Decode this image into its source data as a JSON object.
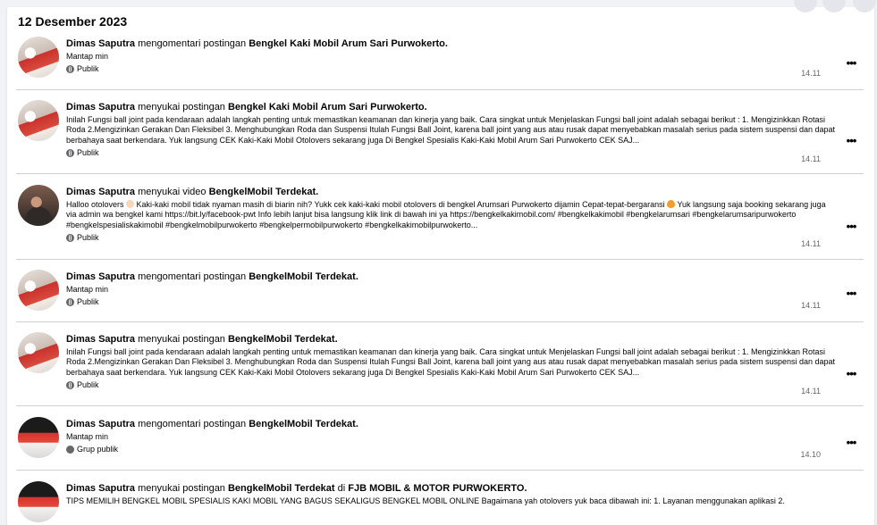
{
  "date_header": "12 Desember 2023",
  "actor": "Dimas Saputra",
  "entries": [
    {
      "avatar": "post-thumbnail",
      "action": " mengomentari postingan ",
      "target": "Bengkel Kaki Mobil Arum Sari Purwokerto.",
      "comment": "Mantap min",
      "description": "",
      "privacy": "Publik",
      "privacy_icon": "globe-icon",
      "time": "14.11"
    },
    {
      "avatar": "post-thumbnail",
      "action": " menyukai postingan ",
      "target": "Bengkel Kaki Mobil Arum Sari Purwokerto.",
      "comment": "",
      "description": "Inilah Fungsi ball joint pada kendaraan adalah langkah penting untuk memastikan keamanan dan kinerja yang baik. Cara singkat untuk Menjelaskan Fungsi ball joint adalah sebagai berikut : 1. Mengizinkkan Rotasi Roda 2.Mengizinkan Gerakan Dan Fleksibel 3. Menghubungkan Roda dan Suspensi Itulah Fungsi Ball Joint, karena ball joint yang aus atau rusak dapat menyebabkan masalah serius pada sistem suspensi dan dapat berbahaya saat berkendara. Yuk langsung CEK Kaki-Kaki Mobil Otolovers sekarang juga Di Bengkel Spesialis Kaki-Kaki Mobil Arum Sari Purwokerto CEK SAJ...",
      "privacy": "Publik",
      "privacy_icon": "globe-icon",
      "time": "14.11"
    },
    {
      "avatar": "person-photo",
      "action": " menyukai video ",
      "target": "BengkelMobil Terdekat.",
      "comment": "",
      "description_parts": [
        "Halloo otolovers ",
        " Kaki-kaki mobil tidak nyaman masih di biarin nih? Yukk cek kaki-kaki mobil otolovers di bengkel Arumsari Purwokerto dijamin Cepat-tepat-bergaransi ",
        " Yuk langsung saja booking sekarang juga via admin wa bengkel kami https://bit.ly/facebook-pwt Info lebih lanjut bisa langsung klik link di bawah ini ya https://bengkelkakimobil.com/ #bengkelkakimobil #bengkelarumsari #bengkelarumsaripurwokerto #bengkelspesialiskakimobil #bengkelmobilpurwokerto #bengkelpermobilpurwokerto #bengkelkakimobilpurwokerto..."
      ],
      "privacy": "Publik",
      "privacy_icon": "globe-icon",
      "time": "14.11"
    },
    {
      "avatar": "post-thumbnail",
      "action": " mengomentari postingan ",
      "target": "BengkelMobil Terdekat.",
      "comment": "Mantap min",
      "description": "",
      "privacy": "Publik",
      "privacy_icon": "globe-icon",
      "time": "14.11"
    },
    {
      "avatar": "post-thumbnail",
      "action": " menyukai postingan ",
      "target": "BengkelMobil Terdekat.",
      "comment": "",
      "description": "Inilah Fungsi ball joint pada kendaraan adalah langkah penting untuk memastikan keamanan dan kinerja yang baik. Cara singkat untuk Menjelaskan Fungsi ball joint adalah sebagai berikut : 1. Mengizinkkan Rotasi Roda 2.Mengizinkan Gerakan Dan Fleksibel 3. Menghubungkan Roda dan Suspensi Itulah Fungsi Ball Joint, karena ball joint yang aus atau rusak dapat menyebabkan masalah serius pada sistem suspensi dan dapat berbahaya saat berkendara. Yuk langsung CEK Kaki-Kaki Mobil Otolovers sekarang juga Di Bengkel Spesialis Kaki-Kaki Mobil Arum Sari Purwokerto CEK SAJ...",
      "privacy": "Publik",
      "privacy_icon": "globe-icon",
      "time": "14.11"
    },
    {
      "avatar": "dark-thumbnail",
      "action": " mengomentari postingan ",
      "target": "BengkelMobil Terdekat.",
      "comment": "Mantap min",
      "description": "",
      "privacy": "Grup publik",
      "privacy_icon": "group-icon",
      "time": "14.10"
    },
    {
      "avatar": "dark-thumbnail",
      "action": " menyukai postingan ",
      "target": "BengkelMobil Terdekat",
      "connector": " di ",
      "target2": "FJB MOBIL & MOTOR PURWOKERTO.",
      "comment": "",
      "description": "TIPS MEMILIH BENGKEL MOBIL SPESIALIS KAKI MOBIL YANG BAGUS SEKALIGUS BENGKEL MOBIL ONLINE Bagaimana yah otolovers yuk baca dibawah ini: 1. Layanan menggunakan aplikasi 2.",
      "privacy": "",
      "privacy_icon": "globe-icon",
      "time": ""
    }
  ],
  "more_label": "•••",
  "colors": {
    "background": "#f0f2f5",
    "card": "#ffffff",
    "divider": "#ced0d4",
    "muted": "#65676b"
  }
}
